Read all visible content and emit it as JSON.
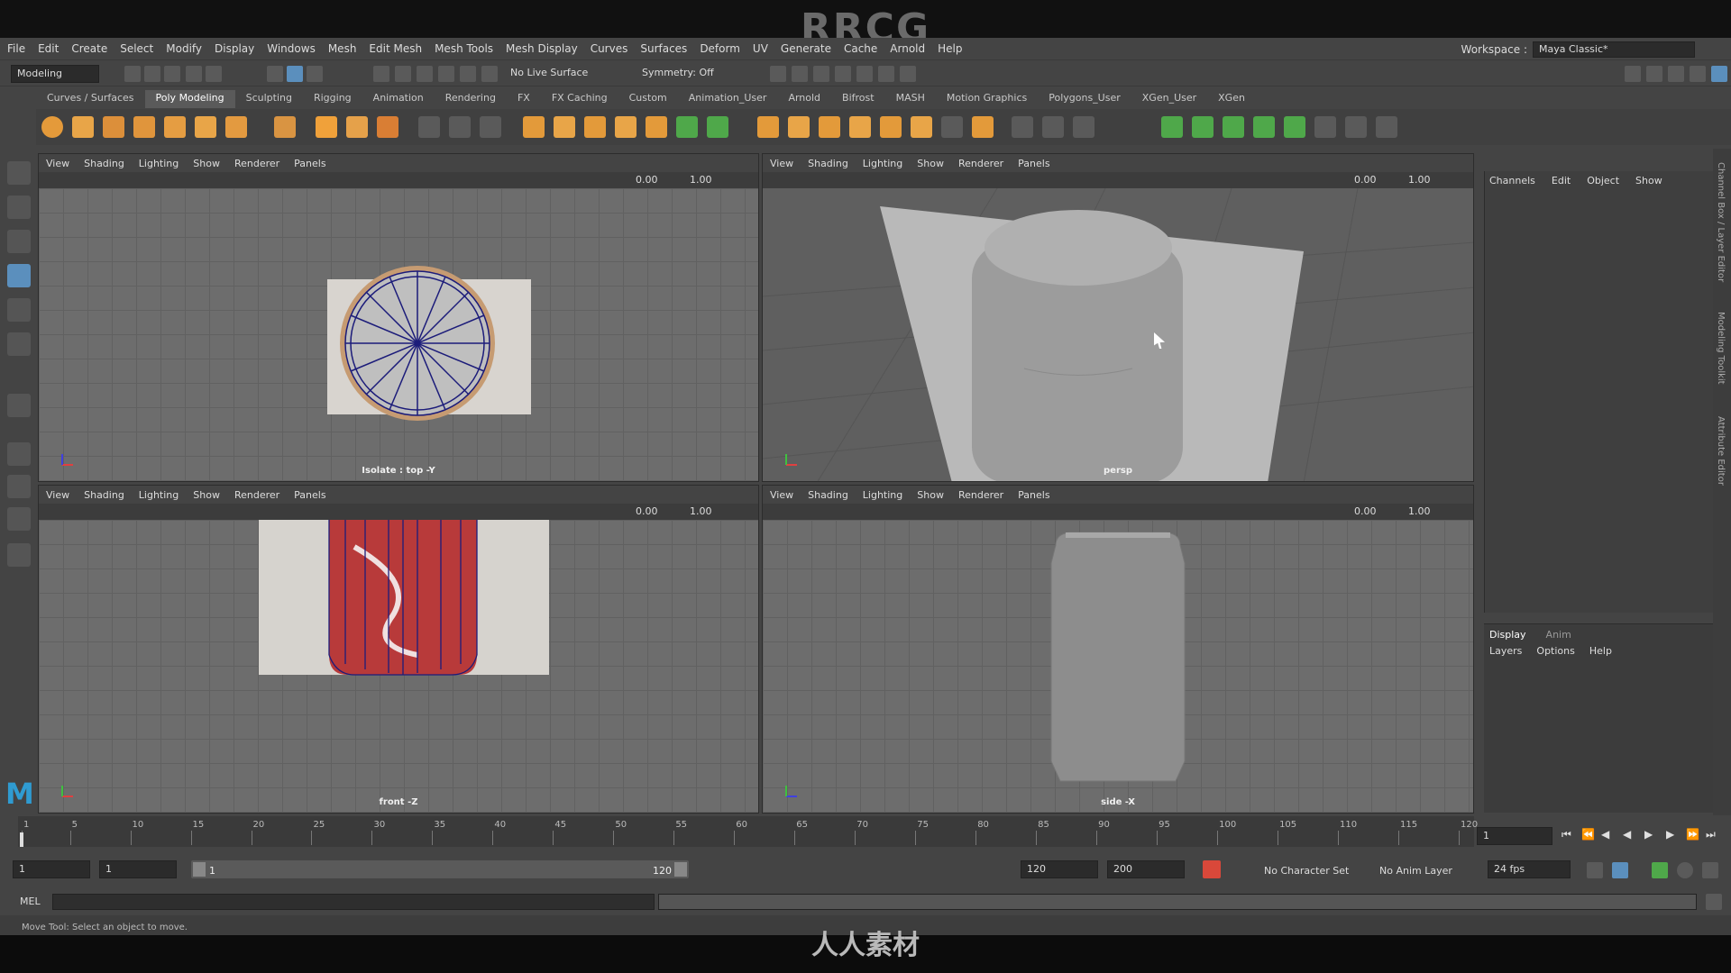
{
  "watermark_top": "RRCG",
  "watermark_bottom": "人人素材",
  "menu": [
    "File",
    "Edit",
    "Create",
    "Select",
    "Modify",
    "Display",
    "Windows",
    "Mesh",
    "Edit Mesh",
    "Mesh Tools",
    "Mesh Display",
    "Curves",
    "Surfaces",
    "Deform",
    "UV",
    "Generate",
    "Cache",
    "Arnold",
    "Help"
  ],
  "workspace": {
    "label": "Workspace :",
    "value": "Maya Classic*"
  },
  "status": {
    "mode": "Modeling",
    "live_surface": "No Live Surface",
    "symmetry": "Symmetry: Off"
  },
  "shelf_tabs": [
    "Curves / Surfaces",
    "Poly Modeling",
    "Sculpting",
    "Rigging",
    "Animation",
    "Rendering",
    "FX",
    "FX Caching",
    "Custom",
    "Animation_User",
    "Arnold",
    "Bifrost",
    "MASH",
    "Motion Graphics",
    "Polygons_User",
    "XGen_User",
    "XGen"
  ],
  "shelf_active": "Poly Modeling",
  "viewport_menu": [
    "View",
    "Shading",
    "Lighting",
    "Show",
    "Renderer",
    "Panels"
  ],
  "viewport_values": {
    "offset": "0.00",
    "scale": "1.00"
  },
  "viewports": {
    "top": {
      "label": "Isolate : top -Y"
    },
    "persp": {
      "label": "persp"
    },
    "front": {
      "label": "front -Z"
    },
    "side": {
      "label": "side -X"
    }
  },
  "channel_box": {
    "menu": [
      "Channels",
      "Edit",
      "Object",
      "Show"
    ]
  },
  "layer_editor": {
    "tabs": [
      "Display",
      "Anim"
    ],
    "menu": [
      "Layers",
      "Options",
      "Help"
    ]
  },
  "side_labels": [
    "Channel Box / Layer Editor",
    "Modeling Toolkit",
    "Attribute Editor"
  ],
  "timeline": {
    "ticks": [
      "1",
      "5",
      "10",
      "15",
      "20",
      "25",
      "30",
      "35",
      "40",
      "45",
      "50",
      "55",
      "60",
      "65",
      "70",
      "75",
      "80",
      "85",
      "90",
      "95",
      "100",
      "105",
      "110",
      "115",
      "120"
    ],
    "current_frame": "1"
  },
  "range": {
    "start": "1",
    "playback_start": "1",
    "slider_start": "1",
    "slider_end": "120",
    "playback_end": "120",
    "end": "200",
    "character_set": "No Character Set",
    "anim_layer": "No Anim Layer",
    "fps": "24 fps"
  },
  "cmdline": {
    "label": "MEL"
  },
  "help_line": "Move Tool: Select an object to move.",
  "colors": {
    "accent": "#5b8fbd",
    "maya_logo": "#2f9bd1",
    "can_red": "#b83a3a"
  }
}
